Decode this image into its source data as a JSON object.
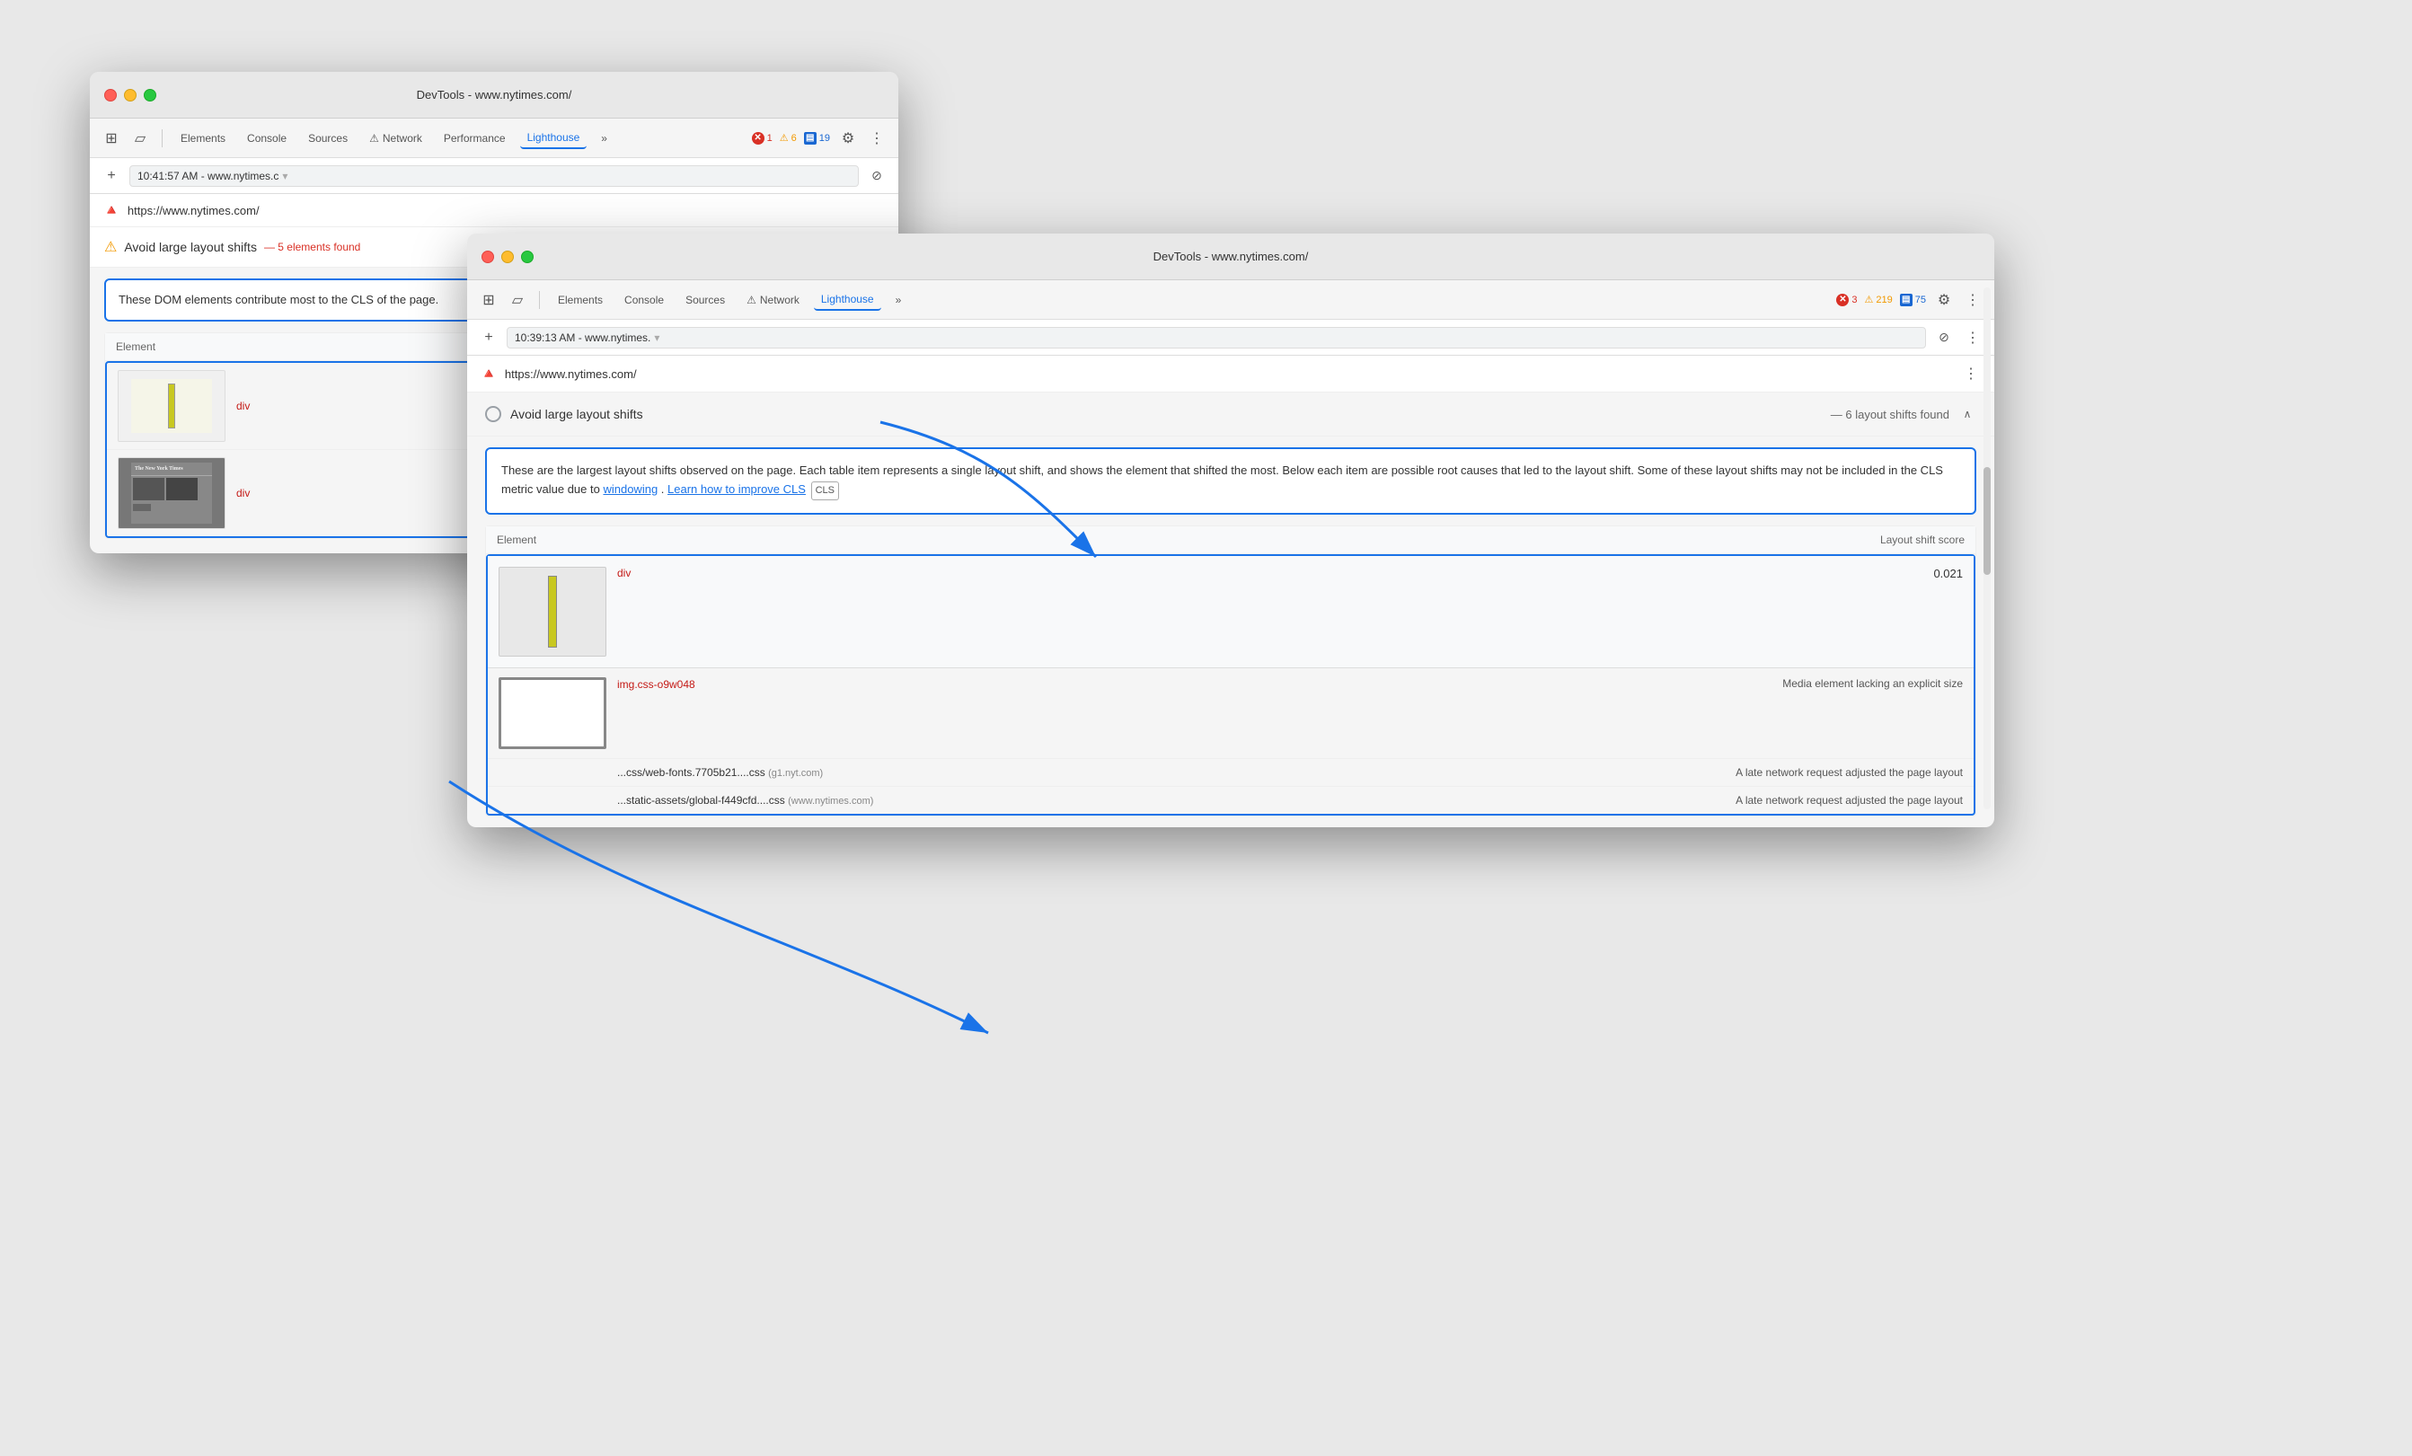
{
  "window_back": {
    "titlebar": "DevTools - www.nytimes.com/",
    "tabs": {
      "elements": "Elements",
      "console": "Console",
      "sources": "Sources",
      "network": "Network",
      "performance": "Performance",
      "lighthouse": "Lighthouse",
      "more": "»"
    },
    "badges": {
      "errors": "1",
      "warnings": "6",
      "info": "19"
    },
    "url_bar": {
      "time": "10:41:57 AM - www.nytimes.c",
      "url": "https://www.nytimes.com/"
    },
    "audit": {
      "title": "Avoid large layout shifts",
      "badge": "— 5 elements found"
    },
    "description": "These DOM elements contribute most to the CLS of the page.",
    "table": {
      "header": "Element",
      "rows": [
        {
          "tag": "div"
        },
        {
          "tag": "div"
        }
      ]
    }
  },
  "window_front": {
    "titlebar": "DevTools - www.nytimes.com/",
    "tabs": {
      "elements": "Elements",
      "console": "Console",
      "sources": "Sources",
      "network": "Network",
      "lighthouse": "Lighthouse",
      "more": "»"
    },
    "badges": {
      "errors": "3",
      "warnings": "219",
      "info": "75"
    },
    "url_bar": {
      "time": "10:39:13 AM - www.nytimes.",
      "url": "https://www.nytimes.com/"
    },
    "audit": {
      "title": "Avoid large layout shifts",
      "badge": "— 6 layout shifts found"
    },
    "description": "These are the largest layout shifts observed on the page. Each table item represents a single layout shift, and shows the element that shifted the most. Below each item are possible root causes that led to the layout shift. Some of these layout shifts may not be included in the CLS metric value due to",
    "description_link1": "windowing",
    "description_mid": ". ",
    "description_link2": "Learn how to improve CLS",
    "description_cls": "CLS",
    "table": {
      "headers": {
        "element": "Element",
        "score": "Layout shift score"
      },
      "main_row": {
        "tag": "div",
        "score": "0.021"
      },
      "sub_row": {
        "tag": "img.css-o9w048",
        "desc": "Media element lacking an explicit size"
      },
      "network_rows": [
        {
          "file": "...css/web-fonts.7705b21....css",
          "domain": "(g1.nyt.com)",
          "desc": "A late network request adjusted the page layout"
        },
        {
          "file": "...static-assets/global-f449cfd....css",
          "domain": "(www.nytimes.com)",
          "desc": "A late network request adjusted the page layout"
        }
      ]
    }
  }
}
